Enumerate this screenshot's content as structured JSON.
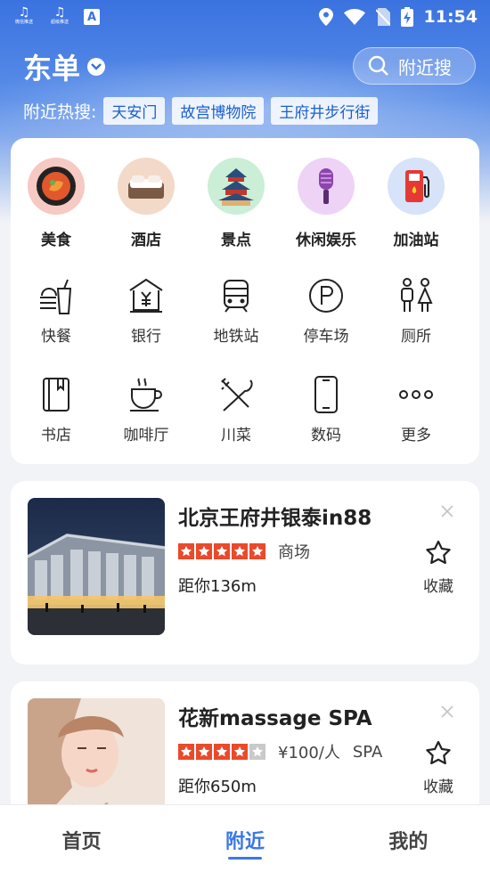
{
  "status_bar": {
    "app1_label": "微信推送",
    "app2_label": "超级推送",
    "app3_label": "A",
    "time": "11:54"
  },
  "header": {
    "city": "东单",
    "search_label": "附近搜",
    "hot_label": "附近热搜:",
    "hot_tags": [
      "天安门",
      "故宫博物院",
      "王府井步行街"
    ]
  },
  "top_categories": [
    {
      "label": "美食",
      "icon": "food-icon",
      "bg": "#f6c9c2"
    },
    {
      "label": "酒店",
      "icon": "hotel-icon",
      "bg": "#f3d9c8"
    },
    {
      "label": "景点",
      "icon": "temple-icon",
      "bg": "#cbeed6"
    },
    {
      "label": "休闲娱乐",
      "icon": "microphone-icon",
      "bg": "#eed3f6"
    },
    {
      "label": "加油站",
      "icon": "gas-station-icon",
      "bg": "#d6e3f9"
    }
  ],
  "grid_categories": [
    {
      "label": "快餐",
      "icon": "fast-food-icon"
    },
    {
      "label": "银行",
      "icon": "bank-icon"
    },
    {
      "label": "地铁站",
      "icon": "subway-icon"
    },
    {
      "label": "停车场",
      "icon": "parking-icon"
    },
    {
      "label": "厕所",
      "icon": "toilet-icon"
    },
    {
      "label": "书店",
      "icon": "book-icon"
    },
    {
      "label": "咖啡厅",
      "icon": "coffee-icon"
    },
    {
      "label": "川菜",
      "icon": "utensils-icon"
    },
    {
      "label": "数码",
      "icon": "phone-icon"
    },
    {
      "label": "更多",
      "icon": "more-icon"
    }
  ],
  "pois": [
    {
      "name": "北京王府井银泰in88",
      "rating": 5,
      "price": "",
      "category": "商场",
      "distance": "距你136m",
      "fav_label": "收藏"
    },
    {
      "name": "花新massage SPA",
      "rating": 4,
      "price": "¥100/人",
      "category": "SPA",
      "distance": "距你650m",
      "fav_label": "收藏"
    }
  ],
  "tabs": [
    "首页",
    "附近",
    "我的"
  ],
  "active_tab": "附近",
  "colors": {
    "accent": "#3a78e6",
    "star": "#ea4a2b"
  }
}
